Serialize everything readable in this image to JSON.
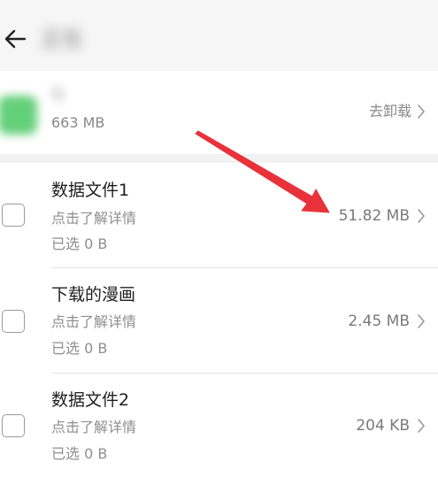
{
  "header": {
    "title": "正在",
    "back_icon": "arrow-left-icon"
  },
  "app": {
    "name": "Q",
    "size": "663 MB",
    "uninstall_label": "去卸载"
  },
  "items": [
    {
      "title": "数据文件1",
      "detail": "点击了解详情",
      "selected": "已选 0 B",
      "size": "51.82 MB"
    },
    {
      "title": "下载的漫画",
      "detail": "点击了解详情",
      "selected": "已选 0 B",
      "size": "2.45 MB"
    },
    {
      "title": "数据文件2",
      "detail": "点击了解详情",
      "selected": "已选 0 B",
      "size": "204 KB"
    }
  ],
  "annotation": {
    "arrow_color": "#e8323a"
  }
}
